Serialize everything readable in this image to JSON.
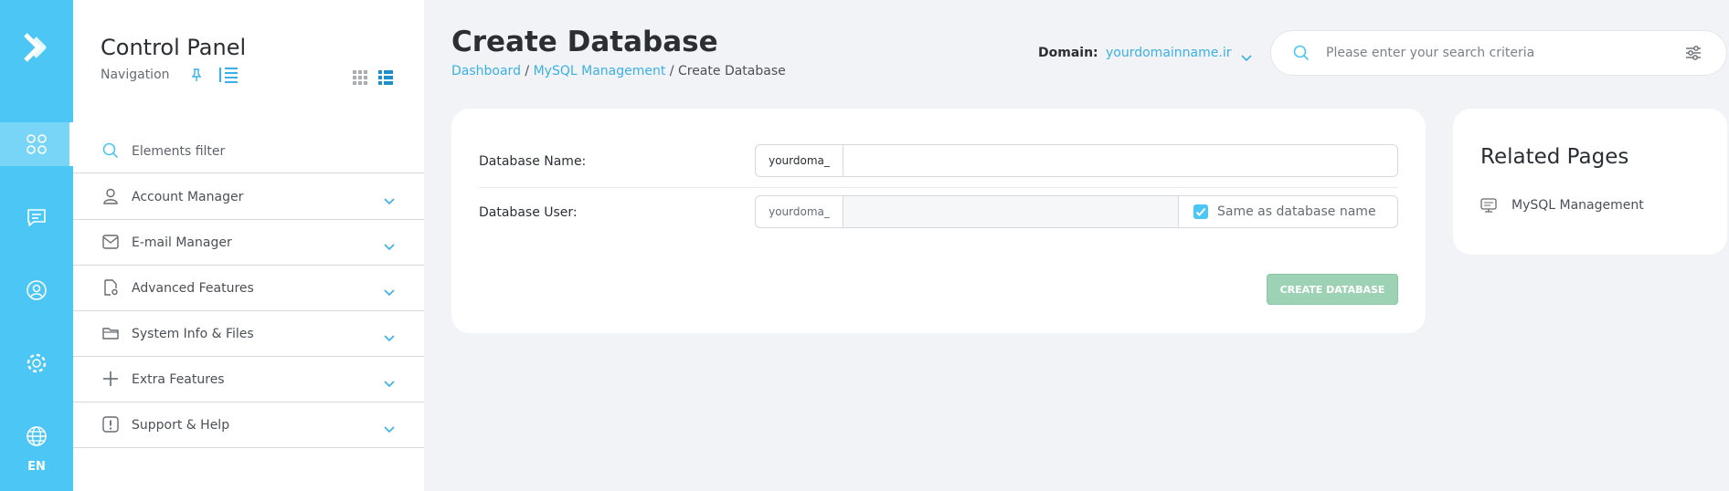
{
  "rail": {
    "items": [
      {
        "icon": "apps-icon"
      },
      {
        "icon": "message-icon"
      },
      {
        "icon": "user-circle-icon"
      },
      {
        "icon": "gear-icon"
      },
      {
        "icon": "globe-icon"
      }
    ],
    "language": "EN",
    "accent_color": "#4cc7f5"
  },
  "sidebar": {
    "title": "Control Panel",
    "subtitle": "Navigation",
    "filter_label": "Elements filter",
    "items": [
      {
        "label": "Account Manager",
        "icon": "user-icon"
      },
      {
        "label": "E-mail Manager",
        "icon": "mail-icon"
      },
      {
        "label": "Advanced Features",
        "icon": "document-gear-icon"
      },
      {
        "label": "System Info & Files",
        "icon": "folder-icon"
      },
      {
        "label": "Extra Features",
        "icon": "plus-icon"
      },
      {
        "label": "Support & Help",
        "icon": "alert-icon"
      }
    ]
  },
  "header": {
    "title": "Create Database",
    "breadcrumb": [
      "Dashboard",
      "MySQL Management",
      "Create Database"
    ],
    "breadcrumb_separator": "/",
    "domain_label": "Domain:",
    "domain_value": "yourdomainname.ir",
    "search_placeholder": "Please enter your search criteria",
    "link_color": "#3ab0e8"
  },
  "form": {
    "db_name_label": "Database Name:",
    "db_name_prefix": "yourdoma_",
    "db_name_value": "",
    "db_user_label": "Database User:",
    "db_user_prefix": "yourdoma_",
    "db_user_value": "",
    "same_as_label": "Same as database name",
    "same_as_checked": true,
    "submit_label": "CREATE DATABASE",
    "submit_color": "#9ed2b4"
  },
  "related": {
    "title": "Related Pages",
    "links": [
      {
        "label": "MySQL Management",
        "icon": "sql-icon"
      }
    ]
  }
}
